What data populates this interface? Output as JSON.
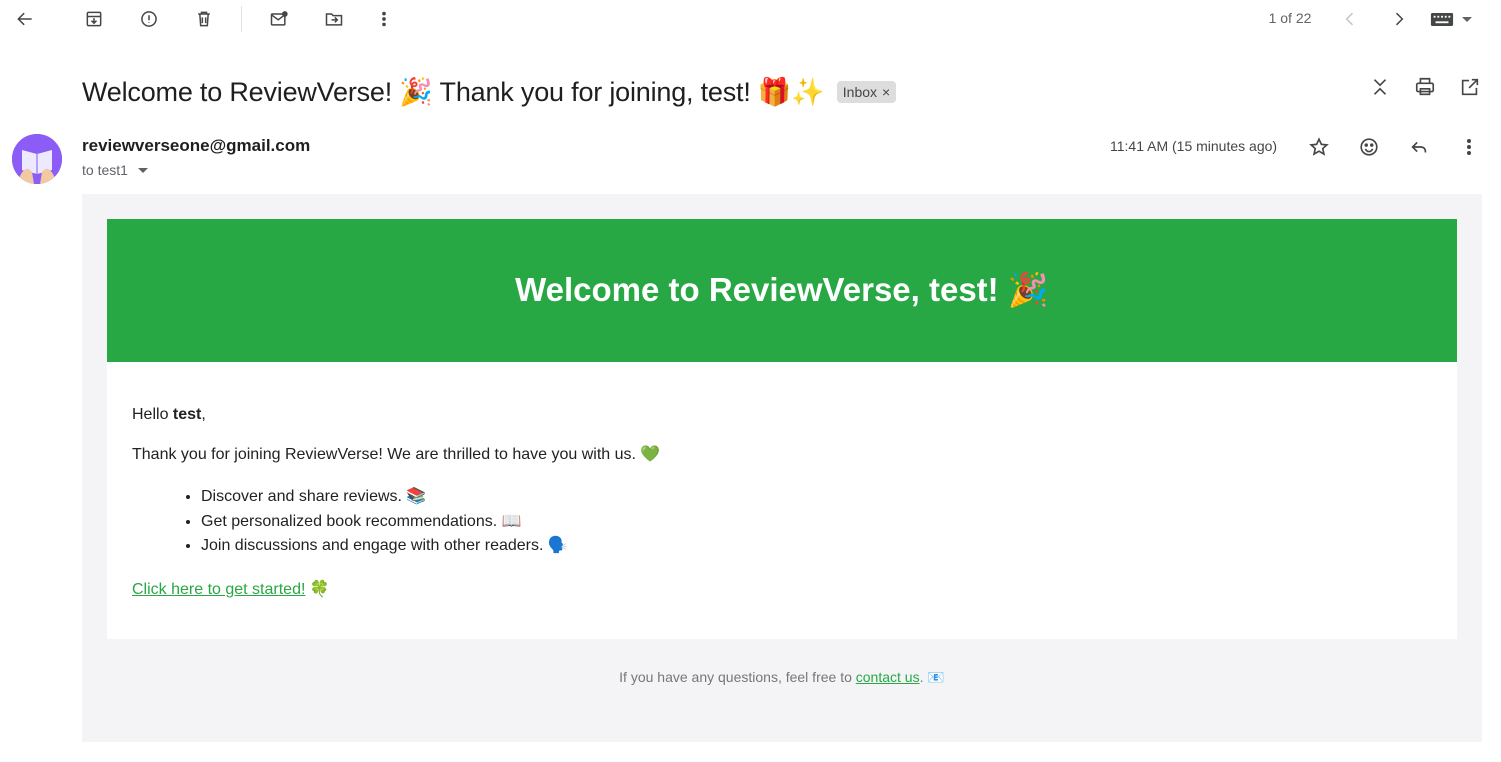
{
  "toolbar": {
    "back": "back-icon",
    "actions": [
      "archive-icon",
      "report-spam-icon",
      "delete-icon",
      "mark-unread-icon",
      "move-to-icon",
      "more-icon"
    ],
    "pager": "1 of 22"
  },
  "subject": "Welcome to ReviewVerse! 🎉 Thank you for joining, test! 🎁✨",
  "label": {
    "text": "Inbox",
    "remove": "×"
  },
  "message": {
    "sender": "reviewverseone@gmail.com",
    "to": "to test1",
    "timestamp": "11:41 AM (15 minutes ago)"
  },
  "email": {
    "banner_title": "Welcome to ReviewVerse, test! 🎉",
    "greeting_prefix": "Hello ",
    "greeting_name": "test",
    "greeting_suffix": ",",
    "intro": "Thank you for joining ReviewVerse! We are thrilled to have you with us. 💚",
    "bullets": [
      "Discover and share reviews. 📚",
      "Get personalized book recommendations. 📖",
      "Join discussions and engage with other readers. 🗣️"
    ],
    "cta_link": "Click here to get started!",
    "cta_emoji": " 🍀",
    "footer_prefix": "If you have any questions, feel free to ",
    "footer_link": "contact us",
    "footer_suffix": ". 📧"
  },
  "colors": {
    "brand_green": "#28a745",
    "body_bg": "#f4f4f7",
    "avatar": "#8b5cf6"
  }
}
